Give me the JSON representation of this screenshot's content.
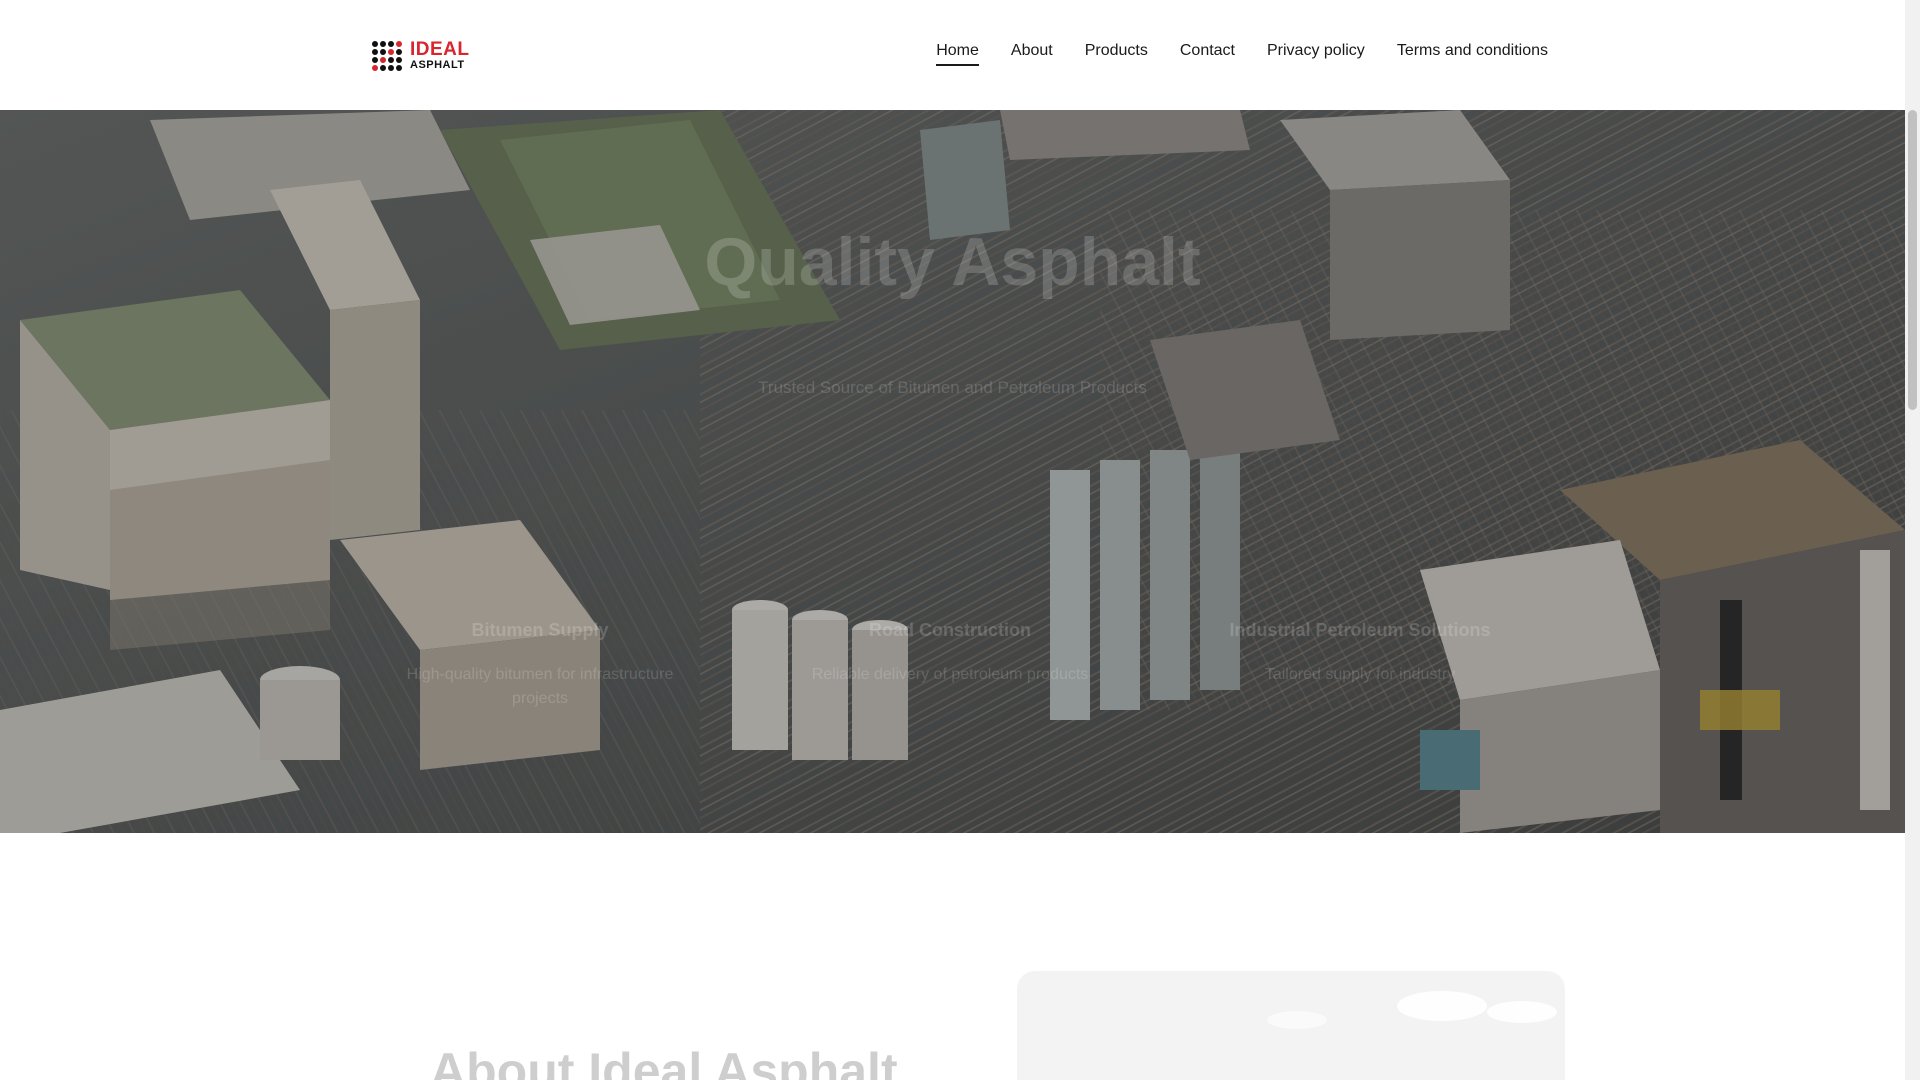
{
  "header": {
    "logo": {
      "line1": "IDEAL",
      "line2": "ASPHALT"
    },
    "nav": [
      {
        "label": "Home",
        "active": true
      },
      {
        "label": "About",
        "active": false
      },
      {
        "label": "Products",
        "active": false
      },
      {
        "label": "Contact",
        "active": false
      },
      {
        "label": "Privacy policy",
        "active": false
      },
      {
        "label": "Terms and conditions",
        "active": false
      }
    ]
  },
  "hero": {
    "title": "Quality Asphalt",
    "subtitle": "Trusted Source of Bitumen and Petroleum Products",
    "features": [
      {
        "title": "Bitumen Supply",
        "description": "High-quality bitumen for infrastructure projects"
      },
      {
        "title": "Road Construction",
        "description": "Reliable delivery of petroleum products"
      },
      {
        "title": "Industrial Petroleum Solutions",
        "description": "Tailored supply for industry"
      }
    ]
  },
  "about": {
    "title": "About Ideal Asphalt"
  },
  "colors": {
    "brand_red": "#d8262f",
    "text": "#1a1a1a",
    "background": "#ffffff"
  }
}
